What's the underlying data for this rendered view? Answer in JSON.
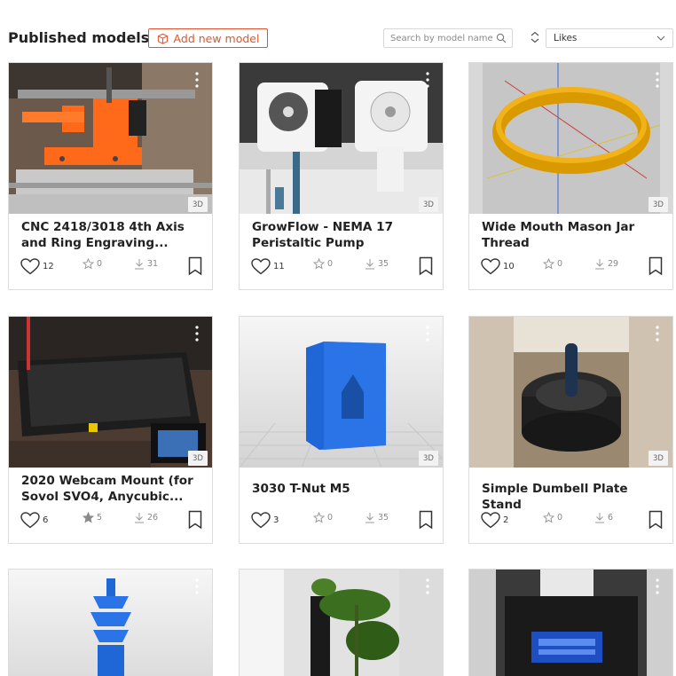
{
  "header": {
    "title": "Published models",
    "add_button_label": "Add new model",
    "search_placeholder": "Search by model name",
    "sort_selected": "Likes"
  },
  "colors": {
    "accent": "#e4532d",
    "border": "#dcdcdc",
    "muted": "#888888"
  },
  "cards": [
    {
      "title": "CNC 2418/3018 4th Axis and Ring Engraving...",
      "likes": "12",
      "stars": "0",
      "downloads": "31",
      "badge": "3D",
      "image": "cnc-orange-4th-axis-photo"
    },
    {
      "title": "GrowFlow - NEMA 17 Peristaltic Pump",
      "likes": "11",
      "stars": "0",
      "downloads": "35",
      "badge": "3D",
      "image": "white-peristaltic-pumps-photo"
    },
    {
      "title": "Wide Mouth Mason Jar Thread",
      "likes": "10",
      "stars": "0",
      "downloads": "29",
      "badge": "3D",
      "image": "yellow-thread-ring-render"
    },
    {
      "title": "2020 Webcam Mount (for Sovol SVO4, Anycubic...",
      "likes": "6",
      "stars": "5",
      "downloads": "26",
      "badge": "3D",
      "image": "3d-printer-bed-photo"
    },
    {
      "title": "3030 T-Nut M5",
      "likes": "3",
      "stars": "0",
      "downloads": "35",
      "badge": "3D",
      "image": "blue-tnut-render"
    },
    {
      "title": "Simple Dumbell Plate Stand",
      "likes": "2",
      "stars": "0",
      "downloads": "6",
      "badge": "3D",
      "image": "dumbbell-plate-stand-photo"
    },
    {
      "title": "",
      "likes": "",
      "stars": "",
      "downloads": "",
      "badge": "",
      "image": "blue-stacked-part-render"
    },
    {
      "title": "",
      "likes": "",
      "stars": "",
      "downloads": "",
      "badge": "",
      "image": "plant-pot-label-photo"
    },
    {
      "title": "",
      "likes": "",
      "stars": "",
      "downloads": "",
      "badge": "",
      "image": "anycubic-printer-screen-photo"
    }
  ]
}
